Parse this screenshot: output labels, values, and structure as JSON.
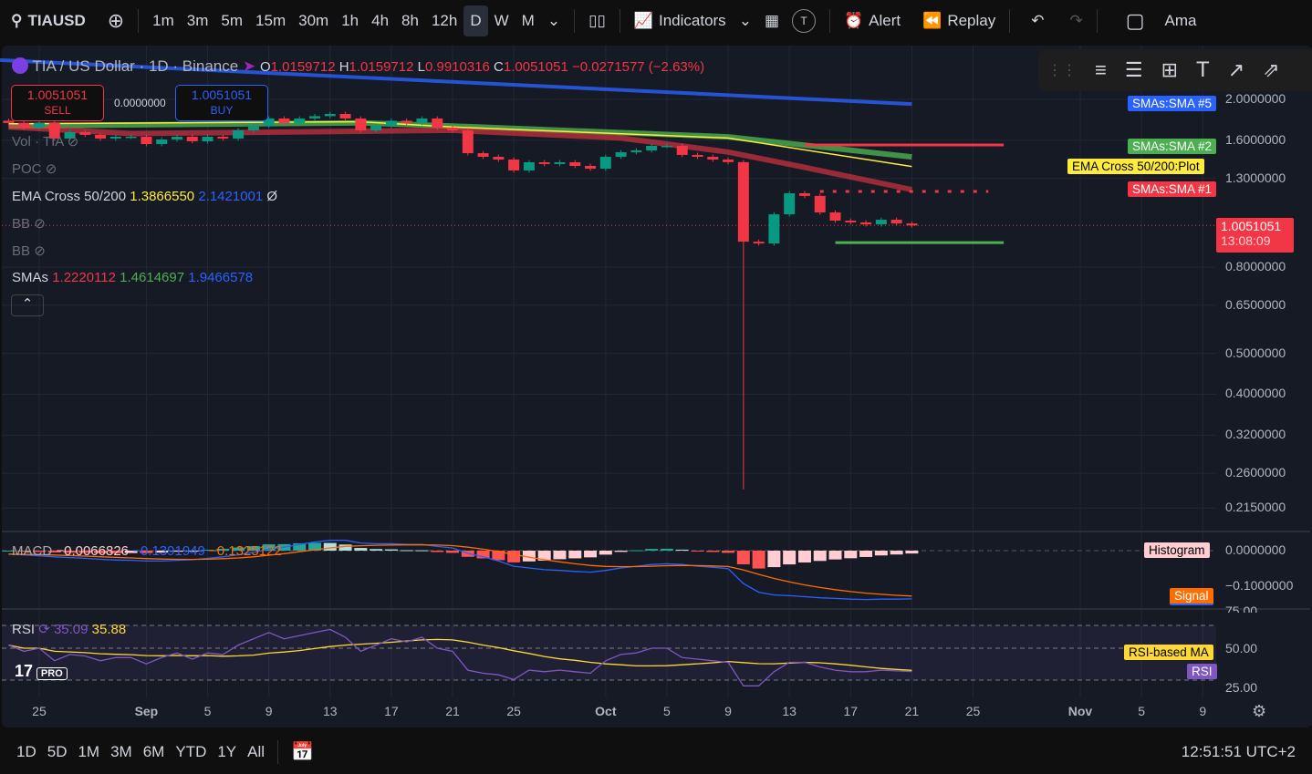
{
  "toolbar": {
    "symbol": "TIAUSD",
    "intervals": [
      "1m",
      "3m",
      "5m",
      "15m",
      "30m",
      "1h",
      "4h",
      "8h",
      "12h",
      "D",
      "W",
      "M"
    ],
    "selected_interval": "D",
    "indicators": "Indicators",
    "avatar": "T",
    "alert": "Alert",
    "replay": "Replay",
    "account": "Ama"
  },
  "legend": {
    "title": "TIA / US Dollar · 1D · Binance",
    "o_label": "O",
    "o": "1.0159712",
    "h_label": "H",
    "h": "1.0159712",
    "l_label": "L",
    "l": "0.9910316",
    "c_label": "C",
    "c": "1.0051051",
    "change": "−0.0271577 (−2.63%)",
    "sell_price": "1.0051051",
    "sell": "SELL",
    "spread": "0.0000000",
    "buy_price": "1.0051051",
    "buy": "BUY",
    "vol": "Vol · TIA",
    "poc": "POC",
    "ema_label": "EMA Cross 50/200",
    "ema1": "1.3866550",
    "ema2": "2.1421001",
    "ema_na": "Ø",
    "bb1": "BB",
    "bb2": "BB",
    "smas_label": "SMAs",
    "sma1": "1.2220112",
    "sma2": "1.4614697",
    "sma3": "1.9466578",
    "macd_label": "MACD",
    "macd1": "−0.0066826",
    "macd2": "−0.1391949",
    "macd3": "−0.1325122",
    "rsi_label": "RSI",
    "rsi1": "35.09",
    "rsi2": "35.88"
  },
  "price_axis": [
    "2.0000000",
    "1.6000000",
    "1.3000000",
    "0.8000000",
    "0.6500000",
    "0.5000000",
    "0.4000000",
    "0.3200000",
    "0.2600000",
    "0.2150000"
  ],
  "price_ticks": [
    2.0,
    1.6,
    1.3,
    0.8,
    0.65,
    0.5,
    0.4,
    0.32,
    0.26,
    0.215
  ],
  "current_price": {
    "value": "1.0051051",
    "countdown": "13:08:09",
    "price": 1.0051051
  },
  "tags": {
    "sma5": "SMAs:SMA #5",
    "sma2": "SMAs:SMA #2",
    "ema": "EMA Cross 50/200:Plot",
    "sma1": "SMAs:SMA #1",
    "histogram": "Histogram",
    "signal": "Signal",
    "rsi_ma": "RSI-based MA",
    "rsi": "RSI"
  },
  "macd_axis": [
    "0.0000000",
    "−0.1000000"
  ],
  "rsi_axis": [
    "75.00",
    "50.00",
    "25.00"
  ],
  "time_axis": [
    "25",
    "Sep",
    "5",
    "9",
    "13",
    "17",
    "21",
    "25",
    "Oct",
    "5",
    "9",
    "13",
    "17",
    "21",
    "25",
    "Nov",
    "5",
    "9"
  ],
  "time_axis_day_index": [
    2,
    9,
    13,
    17,
    21,
    25,
    29,
    33,
    39,
    43,
    47,
    51,
    55,
    59,
    63,
    70,
    74,
    78
  ],
  "ranges": [
    "1D",
    "5D",
    "1M",
    "3M",
    "6M",
    "YTD",
    "1Y",
    "All"
  ],
  "clock": "12:51:51 UTC+2",
  "logo": "TV PRO",
  "colors": {
    "up": "#089981",
    "down": "#f23645",
    "sma5": "#2962ff",
    "sma2": "#4caf50",
    "ema": "#ffeb3b",
    "sma1": "#f23645",
    "macd": "#2962ff",
    "signal": "#ff6d00",
    "rsi": "#7e57c2",
    "rsi_ma": "#fdd835"
  },
  "chart_data": {
    "type": "candlestick",
    "start_date": "Aug 23",
    "end_date": "Oct 21",
    "closes": [
      1.758,
      1.714,
      1.758,
      1.615,
      1.672,
      1.648,
      1.615,
      1.631,
      1.631,
      1.567,
      1.607,
      1.631,
      1.591,
      1.631,
      1.615,
      1.689,
      1.732,
      1.802,
      1.758,
      1.802,
      1.825,
      1.847,
      1.802,
      1.689,
      1.732,
      1.78,
      1.758,
      1.802,
      1.714,
      1.689,
      1.491,
      1.462,
      1.44,
      1.357,
      1.419,
      1.405,
      1.419,
      1.391,
      1.37,
      1.462,
      1.499,
      1.514,
      1.552,
      1.552,
      1.477,
      1.462,
      1.44,
      1.42,
      0.92,
      0.911,
      1.068,
      1.198,
      1.181,
      1.079,
      1.032,
      1.022,
      1.011,
      1.037,
      1.016,
      1.0051051
    ],
    "first_open": 1.78,
    "special_lows": {
      "48": 0.238
    },
    "sma5": [
      [
        0,
        2.48
      ],
      [
        59,
        1.95
      ]
    ],
    "sma2": [
      [
        0,
        1.73
      ],
      [
        23,
        1.76
      ],
      [
        29,
        1.73
      ],
      [
        47,
        1.63
      ],
      [
        59,
        1.4614697
      ]
    ],
    "ema": [
      [
        0,
        1.75
      ],
      [
        23,
        1.77
      ],
      [
        29,
        1.72
      ],
      [
        47,
        1.62
      ],
      [
        59,
        1.386655
      ]
    ],
    "sma1": [
      [
        0,
        1.72
      ],
      [
        8,
        1.66
      ],
      [
        29,
        1.69
      ],
      [
        40,
        1.62
      ],
      [
        47,
        1.5
      ],
      [
        52,
        1.38
      ],
      [
        59,
        1.2220112
      ]
    ],
    "hlines": [
      {
        "price": 1.56,
        "from": 52,
        "to": 65,
        "style": "solid",
        "color": "#f23645"
      },
      {
        "price": 1.21,
        "from": 53,
        "to": 64,
        "style": "dotted",
        "color": "#f23645"
      },
      {
        "price": 0.915,
        "from": 54,
        "to": 65,
        "style": "solid",
        "color": "#4caf50"
      }
    ],
    "macd": [
      -0.01,
      -0.012,
      -0.015,
      -0.018,
      -0.02,
      -0.022,
      -0.025,
      -0.027,
      -0.028,
      -0.03,
      -0.03,
      -0.028,
      -0.026,
      -0.022,
      -0.018,
      -0.012,
      -0.005,
      0.005,
      0.01,
      0.018,
      0.025,
      0.03,
      0.03,
      0.022,
      0.02,
      0.02,
      0.018,
      0.018,
      0.012,
      0.008,
      -0.008,
      -0.018,
      -0.03,
      -0.045,
      -0.05,
      -0.055,
      -0.057,
      -0.06,
      -0.062,
      -0.057,
      -0.05,
      -0.045,
      -0.04,
      -0.038,
      -0.04,
      -0.045,
      -0.048,
      -0.052,
      -0.095,
      -0.12,
      -0.128,
      -0.13,
      -0.133,
      -0.136,
      -0.138,
      -0.14,
      -0.141,
      -0.14,
      -0.14,
      -0.1391949
    ],
    "rsi": [
      52,
      48,
      50,
      42,
      46,
      45,
      42,
      44,
      44,
      40,
      44,
      47,
      43,
      47,
      46,
      52,
      56,
      60,
      56,
      58,
      60,
      62,
      57,
      48,
      52,
      56,
      54,
      57,
      50,
      48,
      36,
      34,
      33,
      30,
      36,
      35,
      36,
      35,
      34,
      42,
      46,
      47,
      50,
      50,
      44,
      43,
      42,
      41,
      26,
      26,
      35,
      41,
      41,
      38,
      36,
      35,
      35,
      36,
      35.5,
      35.09
    ]
  }
}
